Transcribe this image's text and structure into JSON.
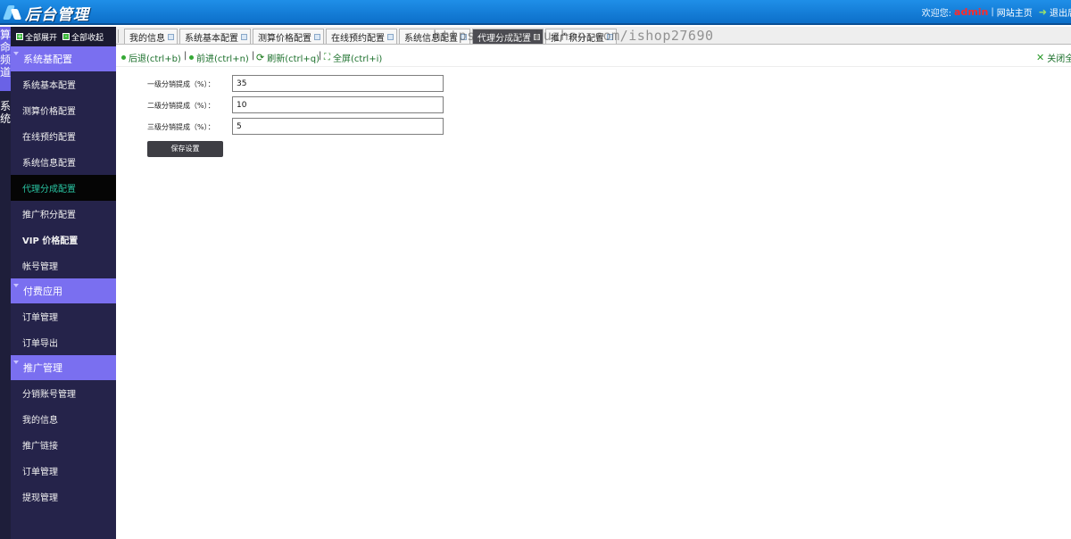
{
  "header": {
    "title": "后台管理",
    "welcome": "欢迎您:",
    "user": "admin",
    "separator": "|",
    "home_link": "网站主页",
    "exit_link": "退出后"
  },
  "leftmost": {
    "top_label": "算命频道",
    "bottom_label": "系统"
  },
  "sidebar": {
    "expand_all": "全部展开",
    "collapse_all": "全部收起",
    "groups": [
      {
        "title": "系统基配置",
        "items": [
          "系统基本配置",
          "测算价格配置",
          "在线预约配置",
          "系统信息配置",
          "代理分成配置",
          "推广积分配置",
          "VIP 价格配置",
          "帐号管理"
        ]
      },
      {
        "title": "付费应用",
        "items": [
          "订单管理",
          "订单导出"
        ]
      },
      {
        "title": "推广管理",
        "items": [
          "分销账号管理",
          "我的信息",
          "推广链接",
          "订单管理",
          "提现管理"
        ]
      }
    ],
    "active_item": "代理分成配置"
  },
  "tabs": [
    "我的信息",
    "系统基本配置",
    "测算价格配置",
    "在线预约配置",
    "系统信息配置",
    "代理分成配置",
    "推广积分配置"
  ],
  "active_tab": "代理分成配置",
  "watermark": "https://www.huzhan.com/ishop27690",
  "toolbar": {
    "back": "后退(ctrl+b)",
    "forward": "前进(ctrl+n)",
    "refresh": "刷新(ctrl+q)",
    "fullscreen": "全屏(ctrl+i)",
    "close_all": "关闭全",
    "separator": "|"
  },
  "form": {
    "fields": [
      {
        "label": "一级分销提成（%）：",
        "value": "35"
      },
      {
        "label": "二级分销提成（%）：",
        "value": "10"
      },
      {
        "label": "三级分销提成（%）：",
        "value": "5"
      }
    ],
    "save_label": "保存设置"
  },
  "colors": {
    "header": "#0c6fc9",
    "sidebar_bg": "#25234a",
    "group_head": "#7a6ff0",
    "active_item_text": "#29c3a1",
    "toolbar_text": "#1a6f2a",
    "user_name": "#ff2a2a"
  }
}
